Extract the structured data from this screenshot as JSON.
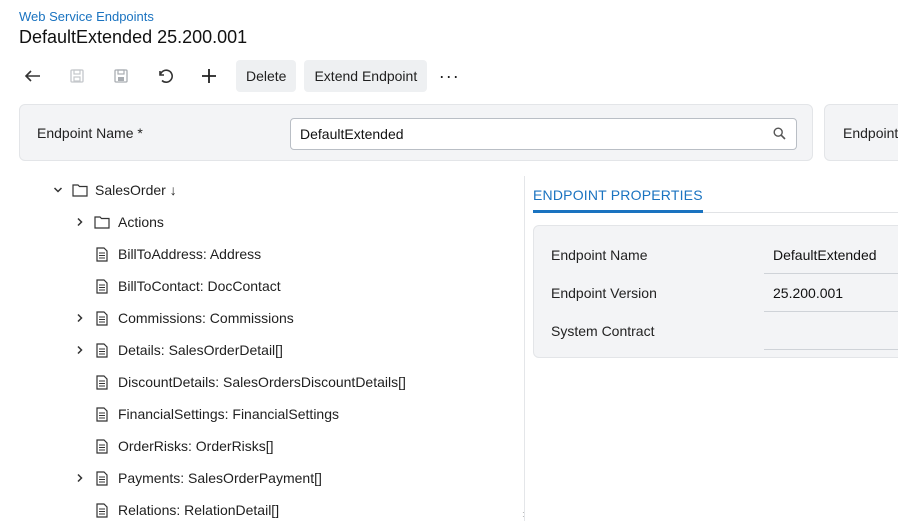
{
  "breadcrumb": "Web Service Endpoints",
  "title": "DefaultExtended 25.200.001",
  "toolbar": {
    "undo_icon": "undo-arrow-icon",
    "delete_label": "Delete",
    "extend_label": "Extend Endpoint",
    "more_label": "···"
  },
  "form": {
    "endpoint_name_label": "Endpoint Name",
    "required_mark": "*",
    "endpoint_name_value": "DefaultExtended",
    "endpoint_label_cut": "Endpoint"
  },
  "tree": {
    "root": {
      "label": "SalesOrder ↓"
    },
    "items": [
      {
        "label": "Actions"
      },
      {
        "label": "BillToAddress: Address"
      },
      {
        "label": "BillToContact: DocContact"
      },
      {
        "label": "Commissions: Commissions"
      },
      {
        "label": "Details: SalesOrderDetail[]"
      },
      {
        "label": "DiscountDetails: SalesOrdersDiscountDetails[]"
      },
      {
        "label": "FinancialSettings: FinancialSettings"
      },
      {
        "label": "OrderRisks: OrderRisks[]"
      },
      {
        "label": "Payments: SalesOrderPayment[]"
      },
      {
        "label": "Relations: RelationDetail[]"
      }
    ]
  },
  "tabs": [
    {
      "label": "ENDPOINT PROPERTIES"
    }
  ],
  "properties": [
    {
      "label": "Endpoint Name",
      "value": "DefaultExtended"
    },
    {
      "label": "Endpoint Version",
      "value": "25.200.001"
    },
    {
      "label": "System Contract",
      "value": ""
    }
  ],
  "colors": {
    "accent": "#1a73c0",
    "panel": "#f3f4f6"
  }
}
